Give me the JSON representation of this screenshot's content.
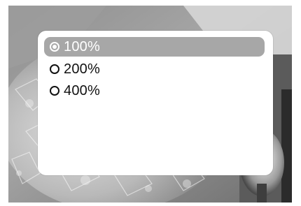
{
  "menu": {
    "options": [
      {
        "label": "100%",
        "selected": true
      },
      {
        "label": "200%",
        "selected": false
      },
      {
        "label": "400%",
        "selected": false
      }
    ]
  },
  "colors": {
    "selection_highlight": "#a7a7a7",
    "panel_background": "#ffffff",
    "text": "#111111",
    "bezel": "#1e1e1e"
  },
  "icons": {
    "selected_option": "radio-selected-icon",
    "unselected_option": "radio-unselected-icon"
  }
}
